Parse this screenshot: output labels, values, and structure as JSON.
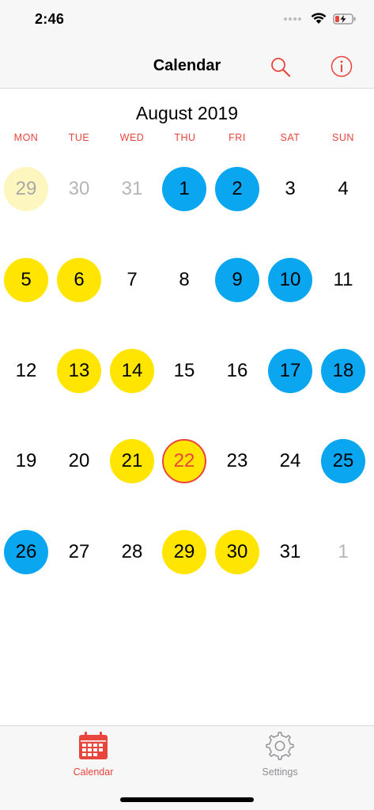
{
  "status_bar": {
    "time": "2:46"
  },
  "nav": {
    "title": "Calendar"
  },
  "calendar": {
    "month_title": "August 2019",
    "weekdays": [
      "MON",
      "TUE",
      "WED",
      "THU",
      "FRI",
      "SAT",
      "SUN"
    ],
    "weeks": [
      [
        {
          "label": "29",
          "style": "paleyellow"
        },
        {
          "label": "30",
          "style": "other"
        },
        {
          "label": "31",
          "style": "other"
        },
        {
          "label": "1",
          "style": "blue"
        },
        {
          "label": "2",
          "style": "blue"
        },
        {
          "label": "3",
          "style": "plain"
        },
        {
          "label": "4",
          "style": "plain"
        }
      ],
      [
        {
          "label": "5",
          "style": "yellow"
        },
        {
          "label": "6",
          "style": "yellow"
        },
        {
          "label": "7",
          "style": "plain"
        },
        {
          "label": "8",
          "style": "plain"
        },
        {
          "label": "9",
          "style": "blue"
        },
        {
          "label": "10",
          "style": "blue"
        },
        {
          "label": "11",
          "style": "plain"
        }
      ],
      [
        {
          "label": "12",
          "style": "plain"
        },
        {
          "label": "13",
          "style": "yellow"
        },
        {
          "label": "14",
          "style": "yellow"
        },
        {
          "label": "15",
          "style": "plain"
        },
        {
          "label": "16",
          "style": "plain"
        },
        {
          "label": "17",
          "style": "blue"
        },
        {
          "label": "18",
          "style": "blue"
        }
      ],
      [
        {
          "label": "19",
          "style": "plain"
        },
        {
          "label": "20",
          "style": "plain"
        },
        {
          "label": "21",
          "style": "yellow"
        },
        {
          "label": "22",
          "style": "today"
        },
        {
          "label": "23",
          "style": "plain"
        },
        {
          "label": "24",
          "style": "plain"
        },
        {
          "label": "25",
          "style": "blue"
        }
      ],
      [
        {
          "label": "26",
          "style": "blue"
        },
        {
          "label": "27",
          "style": "plain"
        },
        {
          "label": "28",
          "style": "plain"
        },
        {
          "label": "29",
          "style": "yellow"
        },
        {
          "label": "30",
          "style": "yellow"
        },
        {
          "label": "31",
          "style": "plain"
        },
        {
          "label": "1",
          "style": "other"
        }
      ]
    ]
  },
  "tab_bar": {
    "items": [
      {
        "label": "Calendar",
        "icon": "calendar-icon",
        "selected": true
      },
      {
        "label": "Settings",
        "icon": "gear-icon",
        "selected": false
      }
    ]
  },
  "colors": {
    "accent_red": "#e8453c",
    "event_blue": "#0aa7f0",
    "event_yellow": "#ffe500",
    "event_pale_yellow": "#fdf6bf",
    "muted_gray": "#8e8e93"
  }
}
